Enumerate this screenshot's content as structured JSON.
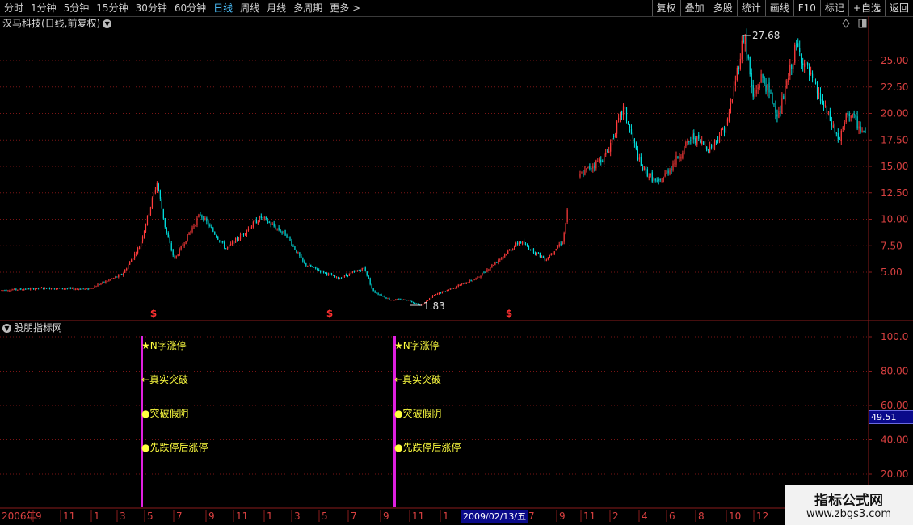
{
  "toolbar": {
    "periods": [
      "分时",
      "1分钟",
      "5分钟",
      "15分钟",
      "30分钟",
      "60分钟",
      "日线",
      "周线",
      "月线",
      "多周期",
      "更多 >"
    ],
    "active_period": "日线",
    "actions": [
      "复权",
      "叠加",
      "多股",
      "统计",
      "画线",
      "F10",
      "标记",
      "+自选",
      "返回"
    ]
  },
  "main_chart": {
    "title": "汉马科技(日线,前复权)",
    "y_ticks": [
      "25.00",
      "22.50",
      "20.00",
      "17.50",
      "15.00",
      "12.50",
      "10.00",
      "7.50",
      "5.00"
    ],
    "high_label": "27.68",
    "low_label": "1.83",
    "dollar_markers": [
      "$",
      "$",
      "$"
    ]
  },
  "indicator": {
    "title": "股朋指标网",
    "y_ticks": [
      "100.0",
      "80.00",
      "60.00",
      "40.00",
      "20.00"
    ],
    "current_value": "49.51",
    "signals": [
      "★N字涨停",
      "←真实突破",
      "●突破假阴",
      "●先跌停后涨停"
    ]
  },
  "x_axis": {
    "year_label": "2006年",
    "month_labels": [
      "9",
      "11",
      "1",
      "3",
      "5",
      "7",
      "9",
      "11",
      "1",
      "3",
      "5",
      "7",
      "9",
      "11",
      "1",
      "7",
      "9",
      "11",
      "2",
      "4",
      "6",
      "8",
      "10",
      "12"
    ],
    "cursor_date": "2009/02/13/五"
  },
  "watermark": {
    "line1": "指标公式网",
    "line2": "www.zbgs3.com"
  },
  "chart_data": {
    "type": "candlestick",
    "x_range_months": "2006-08 to 2011-02",
    "y_range_price": [
      1.5,
      28.5
    ],
    "y_range_indicator": [
      10,
      105
    ],
    "price_path": [
      [
        0,
        3.3
      ],
      [
        0.05,
        3.5
      ],
      [
        0.1,
        3.4
      ],
      [
        0.14,
        4.8
      ],
      [
        0.16,
        7.5
      ],
      [
        0.18,
        13.5
      ],
      [
        0.19,
        9.0
      ],
      [
        0.2,
        6.2
      ],
      [
        0.23,
        10.5
      ],
      [
        0.26,
        7.2
      ],
      [
        0.3,
        10.2
      ],
      [
        0.33,
        8.5
      ],
      [
        0.35,
        5.8
      ],
      [
        0.39,
        4.4
      ],
      [
        0.42,
        5.4
      ],
      [
        0.43,
        3.2
      ],
      [
        0.45,
        2.4
      ],
      [
        0.47,
        2.4
      ],
      [
        0.485,
        1.83
      ],
      [
        0.5,
        2.8
      ],
      [
        0.55,
        4.4
      ],
      [
        0.6,
        7.9
      ],
      [
        0.63,
        6.2
      ],
      [
        0.65,
        8.0
      ],
      [
        0.66,
        13.5
      ],
      [
        0.7,
        16.1
      ],
      [
        0.72,
        20.5
      ],
      [
        0.74,
        15.0
      ],
      [
        0.76,
        13.3
      ],
      [
        0.8,
        17.8
      ],
      [
        0.82,
        16.7
      ],
      [
        0.84,
        19.0
      ],
      [
        0.86,
        27.68
      ],
      [
        0.87,
        21.4
      ],
      [
        0.88,
        23.5
      ],
      [
        0.9,
        19.8
      ],
      [
        0.92,
        26.4
      ],
      [
        0.95,
        21.0
      ],
      [
        0.97,
        17.4
      ],
      [
        0.98,
        20.2
      ],
      [
        1.0,
        17.9
      ]
    ]
  }
}
